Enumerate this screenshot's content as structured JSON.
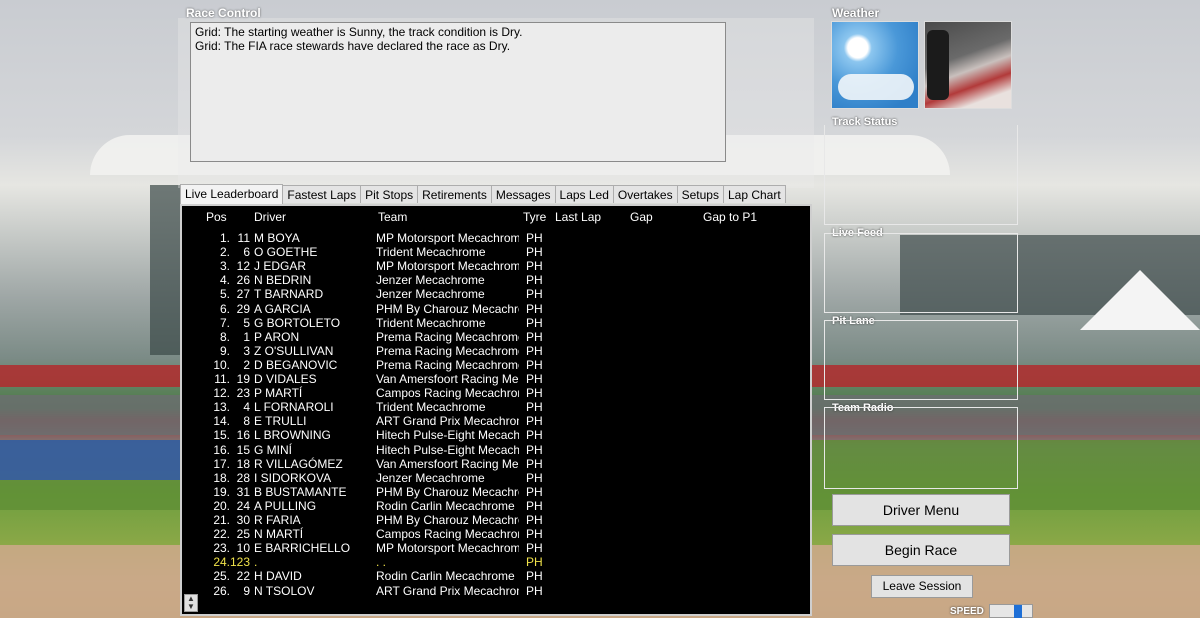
{
  "race_control": {
    "title": "Race Control",
    "messages": [
      "Grid: The starting weather is Sunny, the track condition is Dry.",
      "Grid: The FIA race stewards have declared the race as Dry."
    ]
  },
  "side_panels": {
    "weather": "Weather",
    "track_status": "Track Status",
    "live_feed": "Live Feed",
    "pit_lane": "Pit Lane",
    "team_radio": "Team Radio"
  },
  "tabs": [
    {
      "label": "Live Leaderboard",
      "active": true
    },
    {
      "label": "Fastest Laps",
      "active": false
    },
    {
      "label": "Pit Stops",
      "active": false
    },
    {
      "label": "Retirements",
      "active": false
    },
    {
      "label": "Messages",
      "active": false
    },
    {
      "label": "Laps Led",
      "active": false
    },
    {
      "label": "Overtakes",
      "active": false
    },
    {
      "label": "Setups",
      "active": false
    },
    {
      "label": "Lap Chart",
      "active": false
    }
  ],
  "leaderboard": {
    "columns": {
      "pos": "Pos",
      "driver": "Driver",
      "team": "Team",
      "tyre": "Tyre",
      "last_lap": "Last Lap",
      "gap": "Gap",
      "gap_p1": "Gap to P1"
    },
    "rows": [
      {
        "pos": "1.",
        "num": "11",
        "driver": "M  BOYA",
        "team": "MP Motorsport Mecachrome",
        "tyre": "PH",
        "highlight": false
      },
      {
        "pos": "2.",
        "num": "6",
        "driver": "O  GOETHE",
        "team": "Trident Mecachrome",
        "tyre": "PH",
        "highlight": false
      },
      {
        "pos": "3.",
        "num": "12",
        "driver": "J  EDGAR",
        "team": "MP Motorsport Mecachrome",
        "tyre": "PH",
        "highlight": false
      },
      {
        "pos": "4.",
        "num": "26",
        "driver": "N  BEDRIN",
        "team": "Jenzer Mecachrome",
        "tyre": "PH",
        "highlight": false
      },
      {
        "pos": "5.",
        "num": "27",
        "driver": "T  BARNARD",
        "team": "Jenzer Mecachrome",
        "tyre": "PH",
        "highlight": false
      },
      {
        "pos": "6.",
        "num": "29",
        "driver": "A  GARCIA",
        "team": "PHM By Charouz Mecachrome",
        "tyre": "PH",
        "highlight": false
      },
      {
        "pos": "7.",
        "num": "5",
        "driver": "G  BORTOLETO",
        "team": "Trident Mecachrome",
        "tyre": "PH",
        "highlight": false
      },
      {
        "pos": "8.",
        "num": "1",
        "driver": "P  ARON",
        "team": "Prema Racing Mecachrome",
        "tyre": "PH",
        "highlight": false
      },
      {
        "pos": "9.",
        "num": "3",
        "driver": "Z  O'SULLIVAN",
        "team": "Prema Racing Mecachrome",
        "tyre": "PH",
        "highlight": false
      },
      {
        "pos": "10.",
        "num": "2",
        "driver": "D  BEGANOVIC",
        "team": "Prema Racing Mecachrome",
        "tyre": "PH",
        "highlight": false
      },
      {
        "pos": "11.",
        "num": "19",
        "driver": "D  VIDALES",
        "team": "Van Amersfoort Racing Mecachrome",
        "tyre": "PH",
        "highlight": false
      },
      {
        "pos": "12.",
        "num": "23",
        "driver": "P  MARTÍ",
        "team": "Campos Racing Mecachrome",
        "tyre": "PH",
        "highlight": false
      },
      {
        "pos": "13.",
        "num": "4",
        "driver": "L  FORNAROLI",
        "team": "Trident Mecachrome",
        "tyre": "PH",
        "highlight": false
      },
      {
        "pos": "14.",
        "num": "8",
        "driver": "E  TRULLI",
        "team": "ART Grand Prix Mecachrome",
        "tyre": "PH",
        "highlight": false
      },
      {
        "pos": "15.",
        "num": "16",
        "driver": "L  BROWNING",
        "team": "Hitech Pulse-Eight Mecachrome",
        "tyre": "PH",
        "highlight": false
      },
      {
        "pos": "16.",
        "num": "15",
        "driver": "G  MINÍ",
        "team": "Hitech Pulse-Eight Mecachrome",
        "tyre": "PH",
        "highlight": false
      },
      {
        "pos": "17.",
        "num": "18",
        "driver": "R  VILLAGÓMEZ",
        "team": "Van Amersfoort Racing Mecachrome",
        "tyre": "PH",
        "highlight": false
      },
      {
        "pos": "18.",
        "num": "28",
        "driver": "I  SIDORKOVA",
        "team": "Jenzer Mecachrome",
        "tyre": "PH",
        "highlight": false
      },
      {
        "pos": "19.",
        "num": "31",
        "driver": "B  BUSTAMANTE",
        "team": "PHM By Charouz Mecachrome",
        "tyre": "PH",
        "highlight": false
      },
      {
        "pos": "20.",
        "num": "24",
        "driver": "A  PULLING",
        "team": "Rodin Carlin Mecachrome",
        "tyre": "PH",
        "highlight": false
      },
      {
        "pos": "21.",
        "num": "30",
        "driver": "R  FARIA",
        "team": "PHM By Charouz Mecachrome",
        "tyre": "PH",
        "highlight": false
      },
      {
        "pos": "22.",
        "num": "25",
        "driver": "N  MARTÍ",
        "team": "Campos Racing Mecachrome",
        "tyre": "PH",
        "highlight": false
      },
      {
        "pos": "23.",
        "num": "10",
        "driver": "E  BARRICHELLO",
        "team": "MP Motorsport Mecachrome",
        "tyre": "PH",
        "highlight": false
      },
      {
        "pos": "24.",
        "num": "123",
        "driver": ".",
        "team": ". .",
        "tyre": "PH",
        "highlight": true
      },
      {
        "pos": "25.",
        "num": "22",
        "driver": "H  DAVID",
        "team": "Rodin Carlin Mecachrome",
        "tyre": "PH",
        "highlight": false
      },
      {
        "pos": "26.",
        "num": "9",
        "driver": "N  TSOLOV",
        "team": "ART Grand Prix Mecachrome",
        "tyre": "PH",
        "highlight": false
      }
    ]
  },
  "buttons": {
    "driver_menu": "Driver Menu",
    "begin_race": "Begin Race",
    "leave_session": "Leave Session"
  },
  "speed": {
    "label": "SPEED"
  },
  "colors": {
    "highlight_row": "#f0e24a",
    "speed_knob": "#1e6fd6"
  }
}
